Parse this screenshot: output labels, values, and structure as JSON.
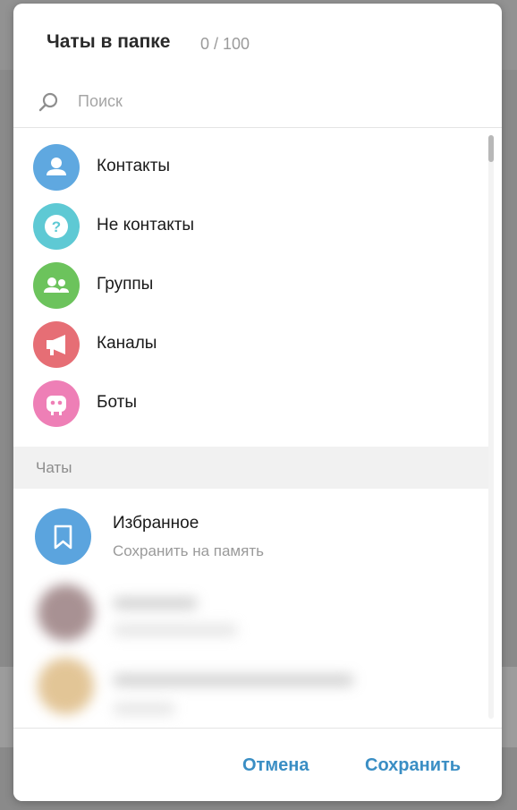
{
  "dialog": {
    "title": "Чаты в папке",
    "counter": "0 / 100"
  },
  "search": {
    "placeholder": "Поиск",
    "value": ""
  },
  "chat_types": [
    {
      "label": "Контакты",
      "icon": "user-icon",
      "color": "#5fa8e0"
    },
    {
      "label": "Не контакты",
      "icon": "question-icon",
      "color": "#5ec9d4"
    },
    {
      "label": "Группы",
      "icon": "group-icon",
      "color": "#6cc35c"
    },
    {
      "label": "Каналы",
      "icon": "megaphone-icon",
      "color": "#e66e75"
    },
    {
      "label": "Боты",
      "icon": "robot-icon",
      "color": "#ee7fb6"
    }
  ],
  "chats_section": {
    "title": "Чаты"
  },
  "chats": [
    {
      "name": "Избранное",
      "subtitle": "Сохранить на память",
      "icon": "bookmark-icon",
      "color": "#5ba4de"
    }
  ],
  "footer": {
    "cancel_label": "Отмена",
    "save_label": "Сохранить"
  },
  "colors": {
    "accent": "#3a8ec4"
  }
}
